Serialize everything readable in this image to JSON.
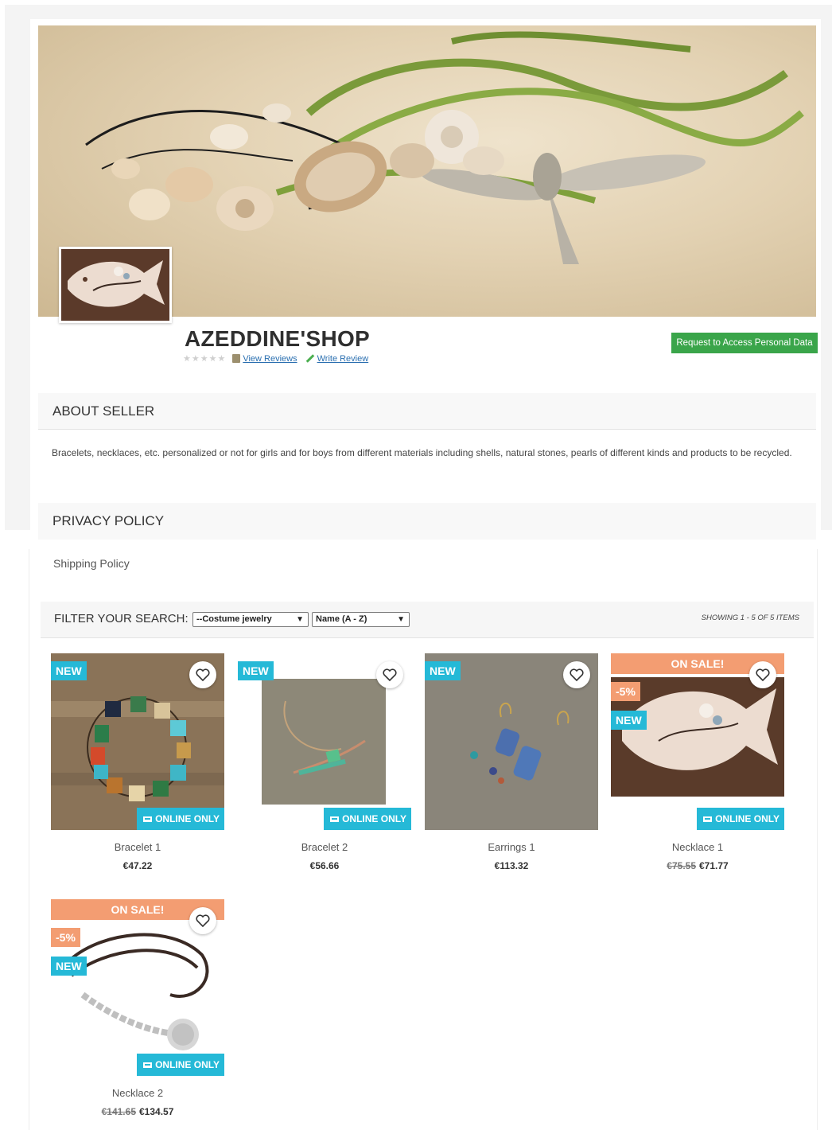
{
  "seller": {
    "name": "AZEDDINE'SHOP",
    "rating_stars": "★★★★★",
    "view_reviews": "View Reviews",
    "write_review": "Write Review",
    "access_button": "Request to Access Personal Data"
  },
  "about": {
    "heading": "ABOUT SELLER",
    "text": "Bracelets, necklaces, etc. personalized or not for girls and for boys from different materials including shells, natural stones, pearls of different kinds and products to be recycled."
  },
  "privacy": {
    "heading": "PRIVACY POLICY"
  },
  "shipping": {
    "label": "Shipping Policy"
  },
  "filter": {
    "label": "FILTER YOUR SEARCH:",
    "category_value": "--Costume jewelry",
    "sort_value": "Name (A - Z)",
    "showing": "SHOWING 1 - 5 OF 5 ITEMS"
  },
  "labels": {
    "new": "NEW",
    "on_sale": "ON SALE!",
    "online_only": "ONLINE ONLY"
  },
  "products": [
    {
      "name": "Bracelet 1",
      "price": "€47.22",
      "old_price": "",
      "discount": "",
      "on_sale": false
    },
    {
      "name": "Bracelet 2",
      "price": "€56.66",
      "old_price": "",
      "discount": "",
      "on_sale": false
    },
    {
      "name": "Earrings 1",
      "price": "€113.32",
      "old_price": "",
      "discount": "",
      "on_sale": false
    },
    {
      "name": "Necklace 1",
      "price": "€71.77",
      "old_price": "€75.55",
      "discount": "-5%",
      "on_sale": true
    },
    {
      "name": "Necklace 2",
      "price": "€134.57",
      "old_price": "€141.65",
      "discount": "-5%",
      "on_sale": true
    }
  ],
  "colors": {
    "accent": "#25b9d7",
    "sale": "#f39d72",
    "access_button": "#3aa54a"
  }
}
